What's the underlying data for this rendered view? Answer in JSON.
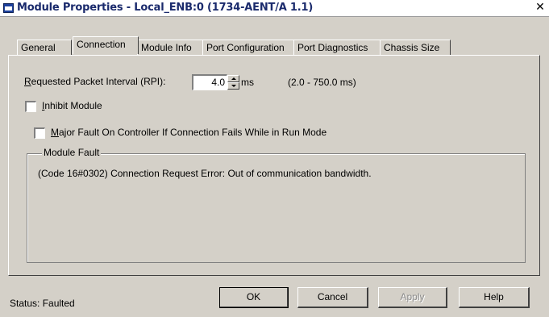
{
  "window": {
    "title": "Module Properties - Local_ENB:0 (1734-AENT/A 1.1)",
    "close_glyph": "✕"
  },
  "tabs": [
    {
      "label": "General"
    },
    {
      "label": "Connection"
    },
    {
      "label": "Module Info"
    },
    {
      "label": "Port Configuration"
    },
    {
      "label": "Port Diagnostics"
    },
    {
      "label": "Chassis Size"
    }
  ],
  "active_tab": "Connection",
  "rpi": {
    "label_first": "R",
    "label_rest": "equested Packet Interval (RPI):",
    "value": "4.0",
    "unit": "ms",
    "range": "(2.0 - 750.0 ms)"
  },
  "inhibit": {
    "label_first": "I",
    "label_rest": "nhibit Module",
    "checked": false
  },
  "major_fault": {
    "label_first": "M",
    "label_rest": "ajor Fault On Controller If Connection Fails While in Run Mode",
    "checked": false
  },
  "module_fault": {
    "legend": "Module Fault",
    "message": "(Code 16#0302) Connection Request Error: Out of communication bandwidth."
  },
  "status": {
    "text": "Status:  Faulted"
  },
  "buttons": {
    "ok": "OK",
    "cancel": "Cancel",
    "apply": "Apply",
    "help": "Help"
  }
}
